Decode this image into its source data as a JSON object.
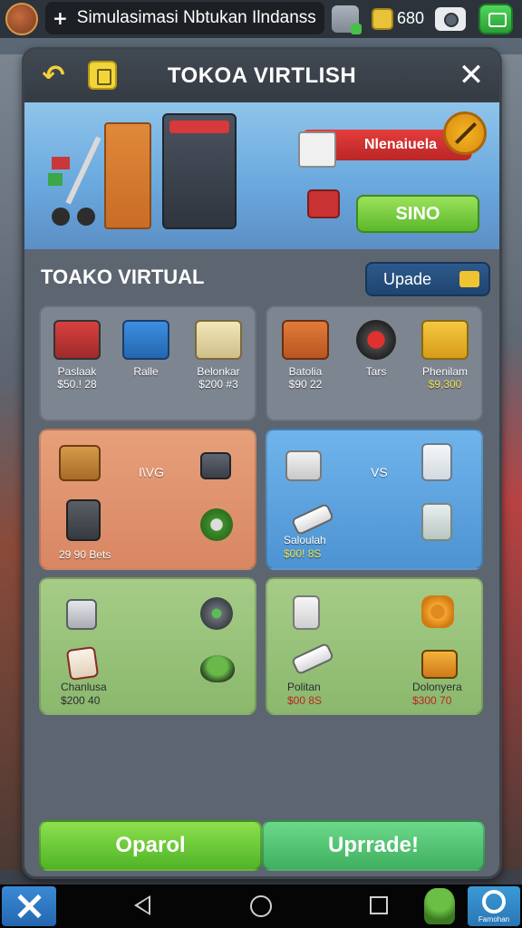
{
  "status_bar": {
    "title": "Simulasimasi Nbtukan Ilndanss",
    "coin_count": "680"
  },
  "panel": {
    "title": "TOKOA VIRTLISH",
    "hero": {
      "sale_label": "Nlenaiuela",
      "button_label": "SINO"
    },
    "section_title": "TOAKO VIRTUAL",
    "upgrade_small_label": "Upade"
  },
  "cards": {
    "row1_left": {
      "items": [
        {
          "name": "Paslaak",
          "price": "$50.! 28",
          "icon": "cash-register-icon",
          "price_color": "white"
        },
        {
          "name": "Ralle",
          "price": "",
          "icon": "scale-icon",
          "price_color": "white"
        },
        {
          "name": "Belonkar",
          "price": "$200 #3",
          "icon": "pos-terminal-icon",
          "price_color": "white"
        }
      ]
    },
    "row1_right": {
      "items": [
        {
          "name": "Batolia",
          "price": "$90 22",
          "icon": "shopping-cart-icon",
          "price_color": "white"
        },
        {
          "name": "Tars",
          "price": "",
          "icon": "tire-icon",
          "price_color": "white"
        },
        {
          "name": "Phenilam",
          "price": "$9,300",
          "icon": "market-stand-icon",
          "price_color": "yellow"
        }
      ]
    },
    "row2_left": {
      "vs_text": "I\\VG",
      "footer_text": "29 90 Bets"
    },
    "row2_right": {
      "vs_text": "VS",
      "label_name": "Saloulah",
      "label_price": "$00! 8S"
    },
    "row3_left": {
      "label_name": "Chanlusa",
      "label_price": "$200 40"
    },
    "row3_right": {
      "label_a_name": "Politan",
      "label_a_price": "$00 8S",
      "label_b_name": "Dolonyera",
      "label_b_price": "$300 70"
    }
  },
  "buttons": {
    "open_label": "Oparol",
    "upgrade_label": "Uprrade!"
  },
  "navbar": {
    "right_label": "Farnohan"
  },
  "colors": {
    "accent_green": "#5cb82c",
    "sale_red": "#d63a3a",
    "panel_bg": "#5d6571",
    "price_yellow": "#f3e55a"
  }
}
